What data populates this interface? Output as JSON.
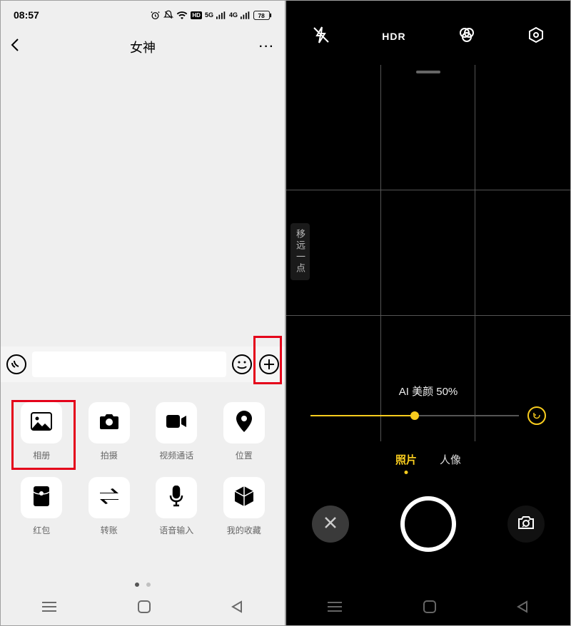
{
  "left": {
    "status": {
      "time": "08:57",
      "battery": "78"
    },
    "chat_title": "女神",
    "panel_items": [
      {
        "key": "album",
        "label": "相册"
      },
      {
        "key": "capture",
        "label": "拍摄"
      },
      {
        "key": "videocall",
        "label": "视频通话"
      },
      {
        "key": "location",
        "label": "位置"
      },
      {
        "key": "redpacket",
        "label": "红包"
      },
      {
        "key": "transfer",
        "label": "转账"
      },
      {
        "key": "voiceinput",
        "label": "语音输入"
      },
      {
        "key": "favorite",
        "label": "我的收藏"
      }
    ]
  },
  "right": {
    "tip": "移远一点",
    "beauty_label": "AI 美颜 50%",
    "beauty_value": 50,
    "modes": [
      {
        "key": "photo",
        "label": "照片",
        "active": true
      },
      {
        "key": "portrait",
        "label": "人像",
        "active": false
      }
    ]
  }
}
